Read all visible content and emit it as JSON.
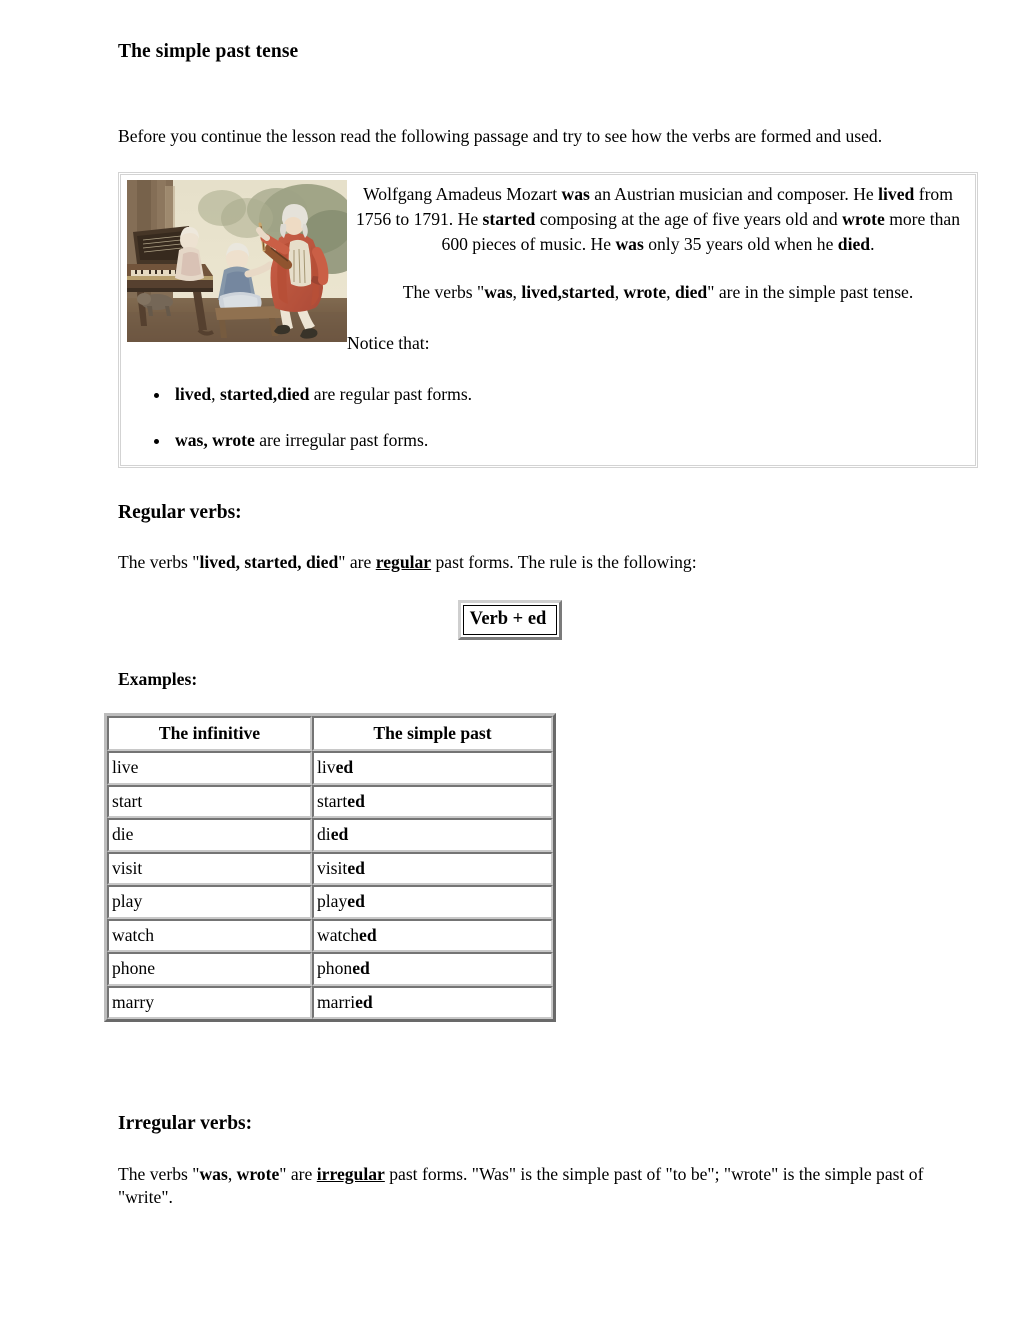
{
  "document": {
    "title": "The simple past tense",
    "intro": "Before you continue the lesson read the following passage and try to see how the verbs are formed and used."
  },
  "passage": {
    "image_alt": "mozart-family-painting",
    "paragraph_parts": [
      {
        "text": "Wolfgang Amadeus Mozart ",
        "bold": false
      },
      {
        "text": "was",
        "bold": true
      },
      {
        "text": " an Austrian musician and composer. He ",
        "bold": false
      },
      {
        "text": "lived",
        "bold": true
      },
      {
        "text": " from 1756 to 1791. He ",
        "bold": false
      },
      {
        "text": "started",
        "bold": true
      },
      {
        "text": " composing at the age of five years old and ",
        "bold": false
      },
      {
        "text": "wrote",
        "bold": true
      },
      {
        "text": " more than 600 pieces of music. He ",
        "bold": false
      },
      {
        "text": "was",
        "bold": true
      },
      {
        "text": " only 35 years old when he ",
        "bold": false
      },
      {
        "text": "died",
        "bold": true
      },
      {
        "text": ".",
        "bold": false
      }
    ],
    "verbs_line_parts": [
      {
        "text": "The verbs \"",
        "bold": false
      },
      {
        "text": "was",
        "bold": true
      },
      {
        "text": ", ",
        "bold": false
      },
      {
        "text": "lived,started",
        "bold": true
      },
      {
        "text": ", ",
        "bold": false
      },
      {
        "text": "wrote",
        "bold": true
      },
      {
        "text": ", ",
        "bold": false
      },
      {
        "text": "died",
        "bold": true
      },
      {
        "text": "\" are in the simple past tense.",
        "bold": false
      }
    ],
    "notice_label": "Notice that:",
    "bullets": [
      {
        "parts": [
          {
            "text": "lived",
            "bold": true
          },
          {
            "text": ", ",
            "bold": false
          },
          {
            "text": "started,died",
            "bold": true
          },
          {
            "text": " are regular past forms.",
            "bold": false
          }
        ]
      },
      {
        "parts": [
          {
            "text": "was, wrote",
            "bold": true
          },
          {
            "text": " are irregular past forms.",
            "bold": false
          }
        ]
      }
    ]
  },
  "regular_section": {
    "heading": "Regular verbs:",
    "text_parts": [
      {
        "text": "The verbs \"",
        "style": "normal"
      },
      {
        "text": "lived, started, died",
        "style": "bold"
      },
      {
        "text": "\" are ",
        "style": "normal"
      },
      {
        "text": "regular",
        "style": "bold-underline"
      },
      {
        "text": " past forms. The rule is the following:",
        "style": "normal"
      }
    ],
    "rule_box": "Verb + ed",
    "examples_label": "Examples:"
  },
  "verb_table": {
    "headers": [
      "The infinitive",
      "The simple past"
    ],
    "rows": [
      {
        "infinitive": "live",
        "stem": "liv",
        "suffix": "ed"
      },
      {
        "infinitive": "start",
        "stem": "start",
        "suffix": "ed"
      },
      {
        "infinitive": "die",
        "stem": "di",
        "suffix": "ed"
      },
      {
        "infinitive": "visit",
        "stem": "visit",
        "suffix": "ed"
      },
      {
        "infinitive": "play",
        "stem": "play",
        "suffix": "ed"
      },
      {
        "infinitive": "watch",
        "stem": "watch",
        "suffix": "ed"
      },
      {
        "infinitive": "phone",
        "stem": "phon",
        "suffix": "ed"
      },
      {
        "infinitive": "marry",
        "stem": "marri",
        "suffix": "ed"
      }
    ]
  },
  "irregular_section": {
    "heading": "Irregular verbs:",
    "text_parts": [
      {
        "text": "The verbs \"",
        "style": "normal"
      },
      {
        "text": "was",
        "style": "bold"
      },
      {
        "text": ", ",
        "style": "normal"
      },
      {
        "text": "wrote",
        "style": "bold"
      },
      {
        "text": "\" are ",
        "style": "normal"
      },
      {
        "text": "irregular",
        "style": "bold-underline"
      },
      {
        "text": " past forms. \"Was\" is the simple past of \"to be\"; \"wrote\" is the simple past of \"write\".",
        "style": "normal"
      }
    ]
  },
  "colors": {
    "text": "#000000",
    "background": "#ffffff",
    "box_border": "#d3d3d3",
    "table_border": "#bdbdbd"
  }
}
